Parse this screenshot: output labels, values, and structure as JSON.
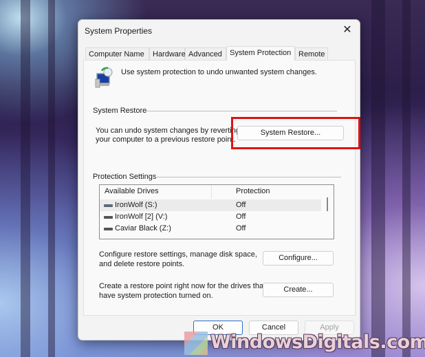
{
  "window": {
    "title": "System Properties",
    "close_icon": "close-icon"
  },
  "tabs": [
    {
      "label": "Computer Name",
      "active": false
    },
    {
      "label": "Hardware",
      "active": false
    },
    {
      "label": "Advanced",
      "active": false
    },
    {
      "label": "System Protection",
      "active": true
    },
    {
      "label": "Remote",
      "active": false
    }
  ],
  "intro": {
    "icon": "system-protection-icon",
    "text": "Use system protection to undo unwanted system changes."
  },
  "system_restore": {
    "group_label": "System Restore",
    "description_line1": "You can undo system changes by reverting",
    "description_line2": "your computer to a previous restore point.",
    "button_label": "System Restore..."
  },
  "protection_settings": {
    "group_label": "Protection Settings",
    "columns": [
      "Available Drives",
      "Protection"
    ],
    "drives": [
      {
        "name": "IronWolf (S:)",
        "protection": "Off",
        "selected": true
      },
      {
        "name": "IronWolf [2] (V:)",
        "protection": "Off",
        "selected": false
      },
      {
        "name": "Caviar Black (Z:)",
        "protection": "Off",
        "selected": false
      }
    ],
    "configure_text_line1": "Configure restore settings, manage disk space,",
    "configure_text_line2": "and delete restore points.",
    "configure_button": "Configure...",
    "create_text_line1": "Create a restore point right now for the drives that",
    "create_text_line2": "have system protection turned on.",
    "create_button": "Create..."
  },
  "footer": {
    "ok": "OK",
    "cancel": "Cancel",
    "apply": "Apply"
  },
  "annotation": {
    "highlight_color": "#e11111"
  },
  "watermark": {
    "text": "WindowsDigitals.com"
  }
}
